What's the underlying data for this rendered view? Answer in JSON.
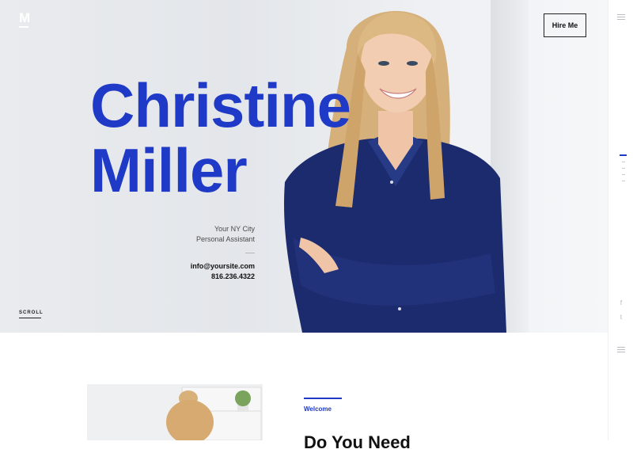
{
  "brand": {
    "logo_letter": "M"
  },
  "header": {
    "hire_label": "Hire Me"
  },
  "hero": {
    "first_name": "Christine",
    "last_name": "Miller",
    "location": "Your NY City",
    "role": "Personal Assistant",
    "email": "info@yoursite.com",
    "phone": "816.236.4322",
    "scroll_label": "SCROLL"
  },
  "about": {
    "eyebrow": "Welcome",
    "heading_partial": "Do You Need"
  },
  "rail": {
    "social": [
      "f",
      "t"
    ]
  },
  "colors": {
    "accent": "#1f3ac6",
    "shirt": "#1c2b6d",
    "hair": "#d9b47a"
  },
  "icons": [
    "menu-icon",
    "facebook-icon",
    "twitter-icon",
    "menu-icon"
  ]
}
